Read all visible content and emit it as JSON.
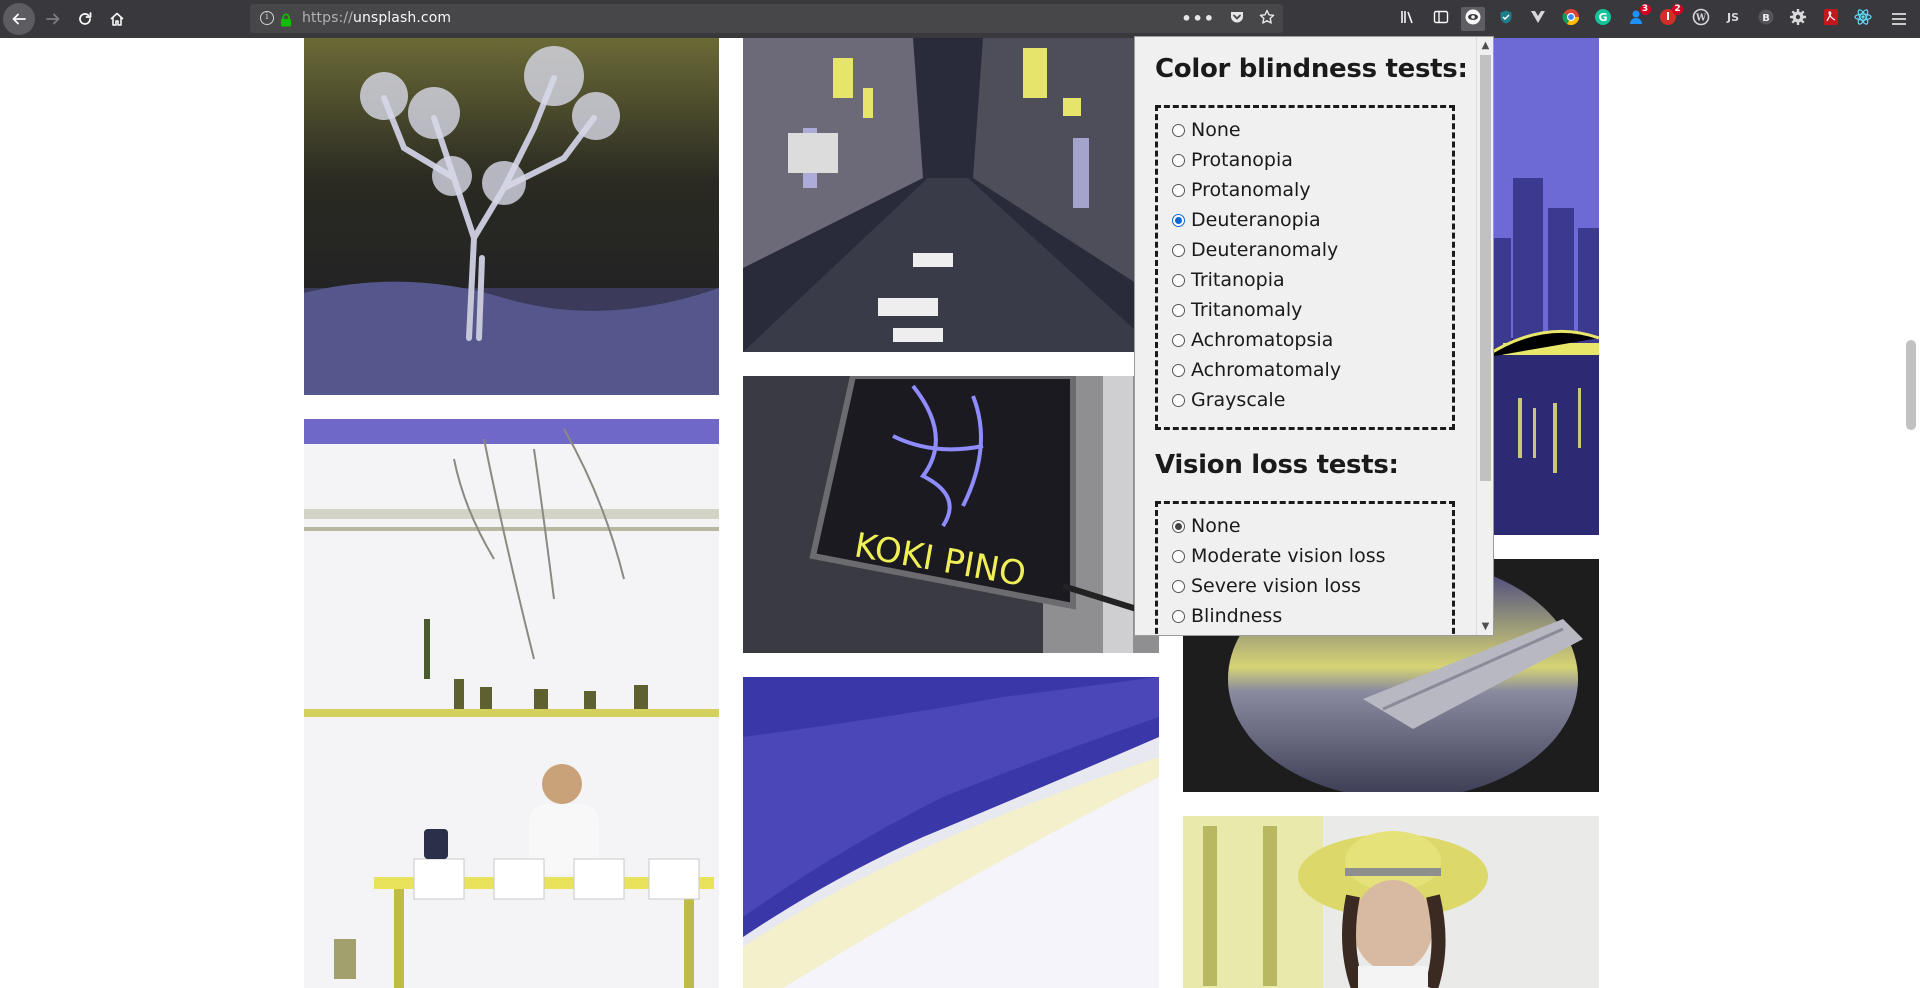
{
  "browser": {
    "url_protocol": "https://",
    "url_host": "unsplash.com",
    "extensions": [
      {
        "name": "library-icon"
      },
      {
        "name": "sidebar-icon"
      },
      {
        "name": "color-blindness-extension-icon",
        "active": true
      },
      {
        "name": "shield-extension-icon"
      },
      {
        "name": "vue-devtools-icon"
      },
      {
        "name": "chrome-icon"
      },
      {
        "name": "grammarly-icon"
      },
      {
        "name": "notifier-icon",
        "badge": "3"
      },
      {
        "name": "lastpass-icon",
        "badge": "2"
      },
      {
        "name": "wordpress-icon"
      },
      {
        "name": "js-icon"
      },
      {
        "name": "b-extension-icon"
      },
      {
        "name": "settings-extension-icon"
      },
      {
        "name": "pdf-icon"
      },
      {
        "name": "react-devtools-icon"
      }
    ]
  },
  "popup": {
    "color_blindness_title": "Color blindness tests:",
    "color_blindness_options": [
      "None",
      "Protanopia",
      "Protanomaly",
      "Deuteranopia",
      "Deuteranomaly",
      "Tritanopia",
      "Tritanomaly",
      "Achromatopsia",
      "Achromatomaly",
      "Grayscale"
    ],
    "color_blindness_selected": "Deuteranopia",
    "vision_loss_title": "Vision loss tests:",
    "vision_loss_options": [
      "None",
      "Moderate vision loss",
      "Severe vision loss",
      "Blindness"
    ],
    "vision_loss_selected": "None"
  },
  "colors": {
    "toolbar_bg": "#38383d",
    "urlbar_bg": "#474749",
    "popup_bg": "#f0f0f0",
    "radio_selected": "#0a66d8"
  },
  "photos": [
    {
      "name": "joshua-tree-night-photo"
    },
    {
      "name": "japanese-street-night-photo"
    },
    {
      "name": "city-river-night-photo"
    },
    {
      "name": "cafe-man-table-photo"
    },
    {
      "name": "neon-sign-photo"
    },
    {
      "name": "airplane-window-photo"
    },
    {
      "name": "aerial-shore-photo"
    },
    {
      "name": "child-sun-hat-photo"
    }
  ]
}
